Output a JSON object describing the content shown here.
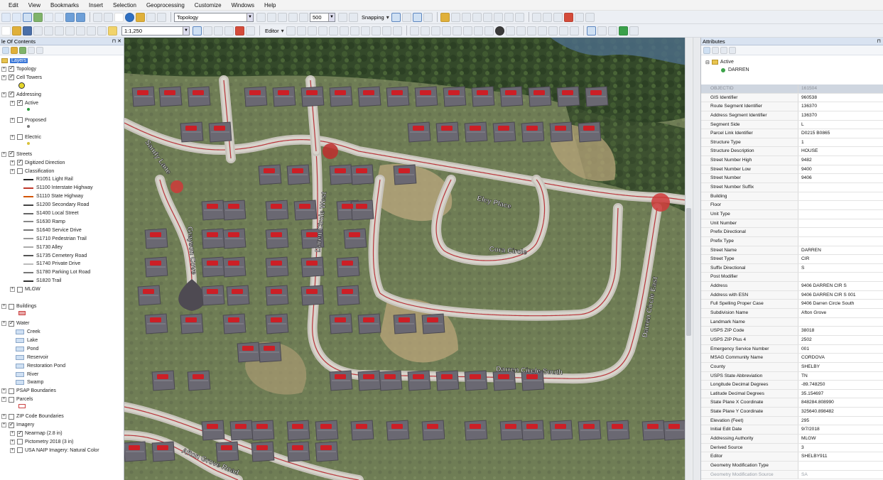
{
  "menu": [
    "Edit",
    "View",
    "Bookmarks",
    "Insert",
    "Selection",
    "Geoprocessing",
    "Customize",
    "Windows",
    "Help"
  ],
  "toolbar": {
    "layer_select": "Topology",
    "scale_percent": "500",
    "snapping_label": "Snapping",
    "map_scale": "1:1,250",
    "editor_label": "Editor"
  },
  "toc": {
    "title": "le Of Contents",
    "rows": [
      {
        "label": "Layers",
        "type": "root"
      },
      {
        "label": "Topology",
        "type": "layer",
        "checked": true
      },
      {
        "label": "Cell Towers",
        "type": "layer",
        "checked": true
      },
      {
        "label": "Addressing",
        "type": "group",
        "checked": true
      },
      {
        "label": "Active",
        "type": "layer",
        "checked": true
      },
      {
        "label": "Proposed",
        "type": "layer",
        "checked": false
      },
      {
        "label": "Electric",
        "type": "layer",
        "checked": false
      },
      {
        "label": "Streets",
        "type": "group",
        "checked": true
      },
      {
        "label": "Digitized Direction",
        "type": "layer",
        "checked": true
      },
      {
        "label": "Classification",
        "type": "layer",
        "checked": false
      },
      {
        "label": "R1051 Light Rail",
        "type": "legend"
      },
      {
        "label": "S1100 Interstate Highway",
        "type": "legend"
      },
      {
        "label": "S1110 State Highway",
        "type": "legend"
      },
      {
        "label": "S1200 Secondary Road",
        "type": "legend"
      },
      {
        "label": "S1400 Local Street",
        "type": "legend"
      },
      {
        "label": "S1630 Ramp",
        "type": "legend"
      },
      {
        "label": "S1640 Service Drive",
        "type": "legend"
      },
      {
        "label": "S1710 Pedestrian Trail",
        "type": "legend"
      },
      {
        "label": "S1730 Alley",
        "type": "legend"
      },
      {
        "label": "S1735 Cemetery Road",
        "type": "legend"
      },
      {
        "label": "S1740 Private Drive",
        "type": "legend"
      },
      {
        "label": "S1780 Parking Lot Road",
        "type": "legend"
      },
      {
        "label": "S1820 Trail",
        "type": "legend"
      },
      {
        "label": "MLGW",
        "type": "layer",
        "checked": false
      },
      {
        "label": "Buildings",
        "type": "group",
        "checked": false
      },
      {
        "label": "Water",
        "type": "group",
        "checked": true
      },
      {
        "label": "Creek",
        "type": "water"
      },
      {
        "label": "Lake",
        "type": "water"
      },
      {
        "label": "Pond",
        "type": "water"
      },
      {
        "label": "Reservoir",
        "type": "water"
      },
      {
        "label": "Restoration Pond",
        "type": "water"
      },
      {
        "label": "River",
        "type": "water"
      },
      {
        "label": "Swamp",
        "type": "water"
      },
      {
        "label": "PSAP Boundaries",
        "type": "group",
        "checked": false
      },
      {
        "label": "Parcels",
        "type": "group",
        "checked": false
      },
      {
        "label": "ZIP Code Boundaries",
        "type": "group",
        "checked": false
      },
      {
        "label": "Imagery",
        "type": "group",
        "checked": true
      },
      {
        "label": "Nearmap (2.8 in)",
        "type": "layer",
        "checked": true
      },
      {
        "label": "Pictometry 2018 (3 in)",
        "type": "layer",
        "checked": false
      },
      {
        "label": "USA NAIP Imagery: Natural Color",
        "type": "layer",
        "checked": false
      }
    ]
  },
  "map": {
    "street_labels": [
      "Daren Circle West",
      "Grayson Cove",
      "Eley Place",
      "Cora Circle",
      "Darren Circle South",
      "Darren Circle East",
      "Afton Grove Road",
      "Sandy Lane"
    ]
  },
  "attributes": {
    "title": "Attributes",
    "tree_parent": "Active",
    "tree_child": "DARREN",
    "rows": [
      {
        "k": "OBJECTID",
        "v": "161504"
      },
      {
        "k": "GIS Identifier",
        "v": "960538"
      },
      {
        "k": "Route Segment Identifier",
        "v": "136370"
      },
      {
        "k": "Address Segment Identifier",
        "v": "136370"
      },
      {
        "k": "Segment Side",
        "v": "L"
      },
      {
        "k": "Parcel Link Identifier",
        "v": "D0215  B0865"
      },
      {
        "k": "Structure Type",
        "v": "1"
      },
      {
        "k": "Structure Description",
        "v": "HOUSE"
      },
      {
        "k": "Street Number High",
        "v": "9482"
      },
      {
        "k": "Street Number Low",
        "v": "9400"
      },
      {
        "k": "Street Number",
        "v": "9406"
      },
      {
        "k": "Street Number Suffix",
        "v": ""
      },
      {
        "k": "Building",
        "v": ""
      },
      {
        "k": "Floor",
        "v": ""
      },
      {
        "k": "Unit Type",
        "v": ""
      },
      {
        "k": "Unit Number",
        "v": ""
      },
      {
        "k": "Prefix Directional",
        "v": ""
      },
      {
        "k": "Prefix Type",
        "v": ""
      },
      {
        "k": "Street Name",
        "v": "DARREN"
      },
      {
        "k": "Street Type",
        "v": "CIR"
      },
      {
        "k": "Suffix Directional",
        "v": "S"
      },
      {
        "k": "Post Modifier",
        "v": ""
      },
      {
        "k": "Address",
        "v": "9406 DARREN CIR S"
      },
      {
        "k": "Address with ESN",
        "v": "9406 DARREN CIR S 001"
      },
      {
        "k": "Full Spelling Proper Case",
        "v": "9406 Darren Circle South"
      },
      {
        "k": "Subdivision Name",
        "v": "Afton Grove"
      },
      {
        "k": "Landmark Name",
        "v": ""
      },
      {
        "k": "USPS ZIP Code",
        "v": "38018"
      },
      {
        "k": "USPS ZIP Plus 4",
        "v": "2502"
      },
      {
        "k": "Emergency Service Number",
        "v": "001"
      },
      {
        "k": "MSAG Community Name",
        "v": "CORDOVA"
      },
      {
        "k": "County",
        "v": "SHELBY"
      },
      {
        "k": "USPS State Abbreviation",
        "v": "TN"
      },
      {
        "k": "Longitude Decimal Degrees",
        "v": "-89.748250"
      },
      {
        "k": "Latitude Decimal Degrees",
        "v": "35.154697"
      },
      {
        "k": "State Plane X Coordinate",
        "v": "848284.808990"
      },
      {
        "k": "State Plane Y Coordinate",
        "v": "325640.898482"
      },
      {
        "k": "Elevation (Feet)",
        "v": "295"
      },
      {
        "k": "Initial Edit Date",
        "v": "9/7/2018"
      },
      {
        "k": "Addressing Authority",
        "v": "MLGW"
      },
      {
        "k": "Derived Source",
        "v": "3"
      },
      {
        "k": "Editor",
        "v": "SHELBY911"
      },
      {
        "k": "Geometry Modification Type",
        "v": ""
      },
      {
        "k": "Geometry Modification Source",
        "v": "SA"
      }
    ]
  }
}
